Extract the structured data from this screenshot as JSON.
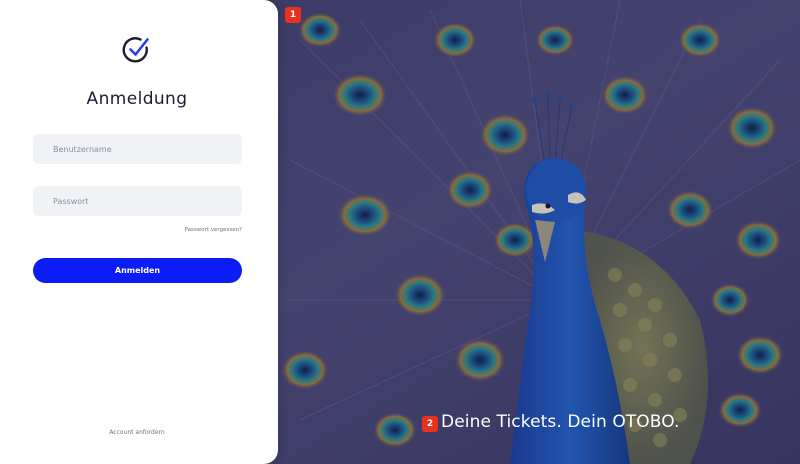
{
  "markers": {
    "one": "1",
    "two": "2"
  },
  "login": {
    "title": "Anmeldung",
    "username_placeholder": "Benutzername",
    "password_placeholder": "Passwort",
    "forgot_password": "Passwort vergessen?",
    "submit_label": "Anmelden",
    "request_account": "Account anfordern"
  },
  "background": {
    "slogan": "Deine Tickets. Dein OTOBO."
  },
  "colors": {
    "primary": "#0c1cf5",
    "title_text": "#1b1d36",
    "field_bg": "#f1f2f6",
    "marker": "#e8321e"
  },
  "icons": {
    "logo": "check-circle-icon"
  }
}
